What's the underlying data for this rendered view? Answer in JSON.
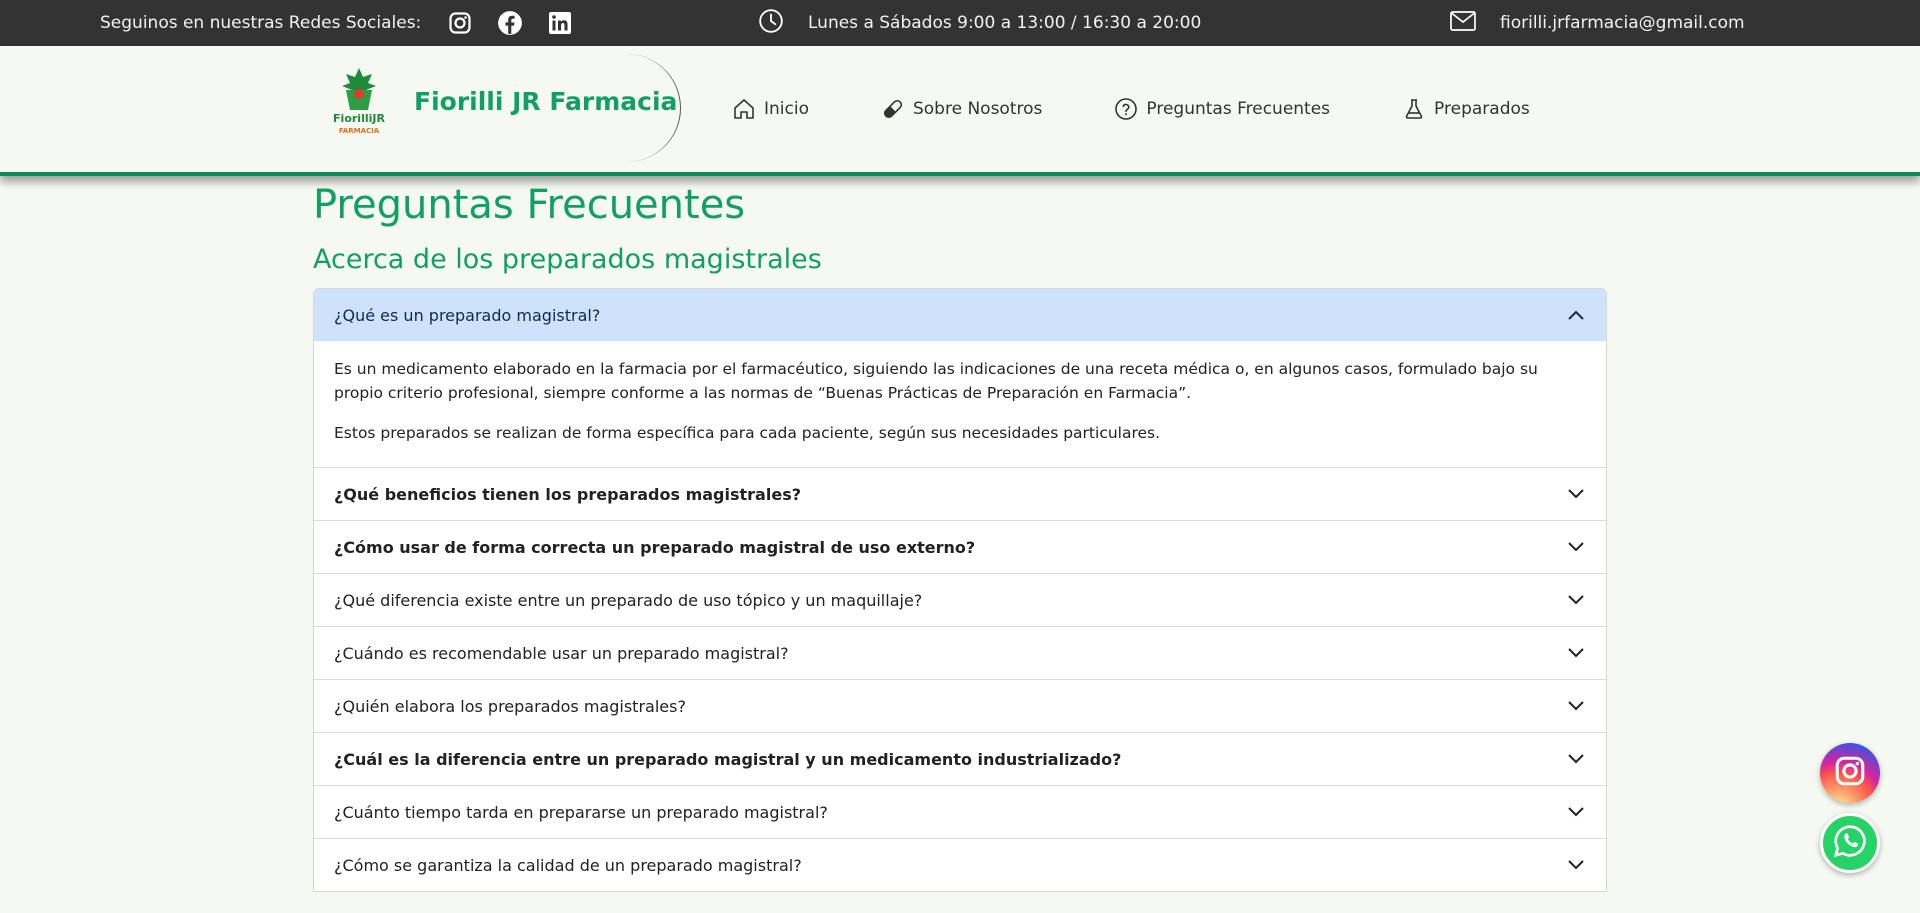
{
  "topbar": {
    "social_label": "Seguinos en nuestras Redes Sociales:",
    "hours": "Lunes a Sábados 9:00 a 13:00 / 16:30 a 20:00",
    "email": "fiorilli.jrfarmacia@gmail.com",
    "icons": [
      "instagram-icon",
      "facebook-icon",
      "linkedin-icon",
      "clock-icon",
      "envelope-icon"
    ]
  },
  "header": {
    "brand_name": "Fiorilli JR Farmacia",
    "logo_text": "FiorilliJR",
    "logo_subtext": "FARMACIA",
    "nav": [
      {
        "label": "Inicio",
        "icon": "home-icon"
      },
      {
        "label": "Sobre Nosotros",
        "icon": "capsule-icon"
      },
      {
        "label": "Preguntas Frecuentes",
        "icon": "question-circle-icon"
      },
      {
        "label": "Preparados",
        "icon": "flask-icon"
      }
    ]
  },
  "main": {
    "title": "Preguntas Frecuentes",
    "section_title": "Acerca de los preparados magistrales",
    "faq": [
      {
        "question": "¿Qué es un preparado magistral?",
        "open": true,
        "answer": [
          "Es un medicamento elaborado en la farmacia por el farmacéutico, siguiendo las indicaciones de una receta médica o, en algunos casos, formulado bajo su propio criterio profesional, siempre conforme a las normas de “Buenas Prácticas de Preparación en Farmacia”.",
          "Estos preparados se realizan de forma específica para cada paciente, según sus necesidades particulares."
        ]
      },
      {
        "question": "¿Qué beneficios tienen los preparados magistrales?",
        "bold": true
      },
      {
        "question": "¿Cómo usar de forma correcta un preparado magistral de uso externo?",
        "bold": true
      },
      {
        "question": "¿Qué diferencia existe entre un preparado de uso tópico y un maquillaje?"
      },
      {
        "question": "¿Cuándo es recomendable usar un preparado magistral?"
      },
      {
        "question": "¿Quién elabora los preparados magistrales?"
      },
      {
        "question": "¿Cuál es la diferencia entre un preparado magistral y un medicamento industrializado?",
        "bold": true
      },
      {
        "question": "¿Cuánto tiempo tarda en prepararse un preparado magistral?"
      },
      {
        "question": "¿Cómo se garantiza la calidad de un preparado magistral?"
      }
    ]
  },
  "floating": {
    "instagram_icon": "instagram-icon",
    "whatsapp_icon": "whatsapp-icon"
  },
  "colors": {
    "brand_green": "#11a063",
    "topbar_bg": "#333333",
    "open_header_bg": "#cfe2fb",
    "page_bg": "#f5f9f2"
  }
}
